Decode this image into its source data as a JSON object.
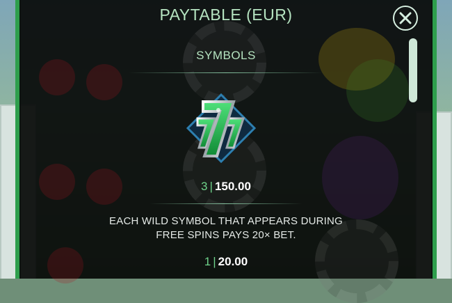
{
  "paytable": {
    "title": "PAYTABLE  (EUR)",
    "section_title": "SYMBOLS",
    "symbols": [
      {
        "icon": "lucky-seven-wild-icon",
        "count": "3",
        "amount": "150.00"
      }
    ],
    "wild_note": "EACH WILD SYMBOL THAT APPEARS DURING FREE SPINS PAYS 20× BET.",
    "wild_pay": {
      "count": "1",
      "amount": "20.00"
    },
    "separator": "|"
  },
  "colors": {
    "accent_green": "#b5e3c0",
    "count_green": "#6fd28a",
    "panel_bg": "#0a0c0b"
  },
  "icons": {
    "close": "close-icon",
    "symbol": "lucky-seven-wild-icon"
  }
}
